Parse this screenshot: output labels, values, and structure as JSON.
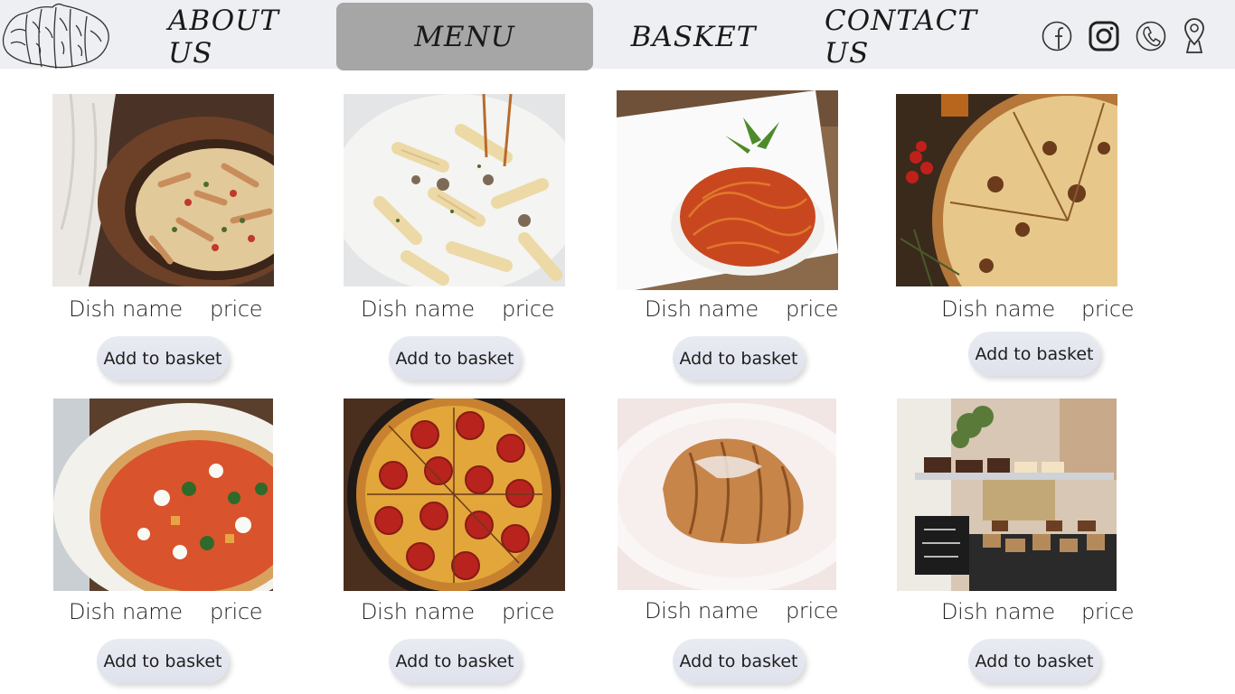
{
  "nav": {
    "items": [
      {
        "label": "ABOUT US"
      },
      {
        "label": "MENU"
      },
      {
        "label": "BASKET"
      },
      {
        "label": "CONTACT US"
      }
    ],
    "social": [
      "facebook-icon",
      "instagram-icon",
      "phone-icon",
      "location-pin-icon"
    ]
  },
  "menu": {
    "items": [
      {
        "name": "Dish name",
        "price": "price",
        "button": "Add to basket",
        "image": "pasta-in-wooden-bowl"
      },
      {
        "name": "Dish name",
        "price": "price",
        "button": "Add to basket",
        "image": "creamy-penne"
      },
      {
        "name": "Dish name",
        "price": "price",
        "button": "Add to basket",
        "image": "spaghetti-tomato"
      },
      {
        "name": "Dish name",
        "price": "price",
        "button": "Add to basket",
        "image": "sliced-pizza"
      },
      {
        "name": "Dish name",
        "price": "price",
        "button": "Add to basket",
        "image": "vegetable-pizza"
      },
      {
        "name": "Dish name",
        "price": "price",
        "button": "Add to basket",
        "image": "pepperoni-pizza"
      },
      {
        "name": "Dish name",
        "price": "price",
        "button": "Add to basket",
        "image": "croissant"
      },
      {
        "name": "Dish name",
        "price": "price",
        "button": "Add to basket",
        "image": "cake-counter"
      }
    ]
  },
  "colors": {
    "nav_bg": "#eeeff2",
    "nav_active": "#a6a6a6",
    "button_bg": "#e2e5ee"
  }
}
